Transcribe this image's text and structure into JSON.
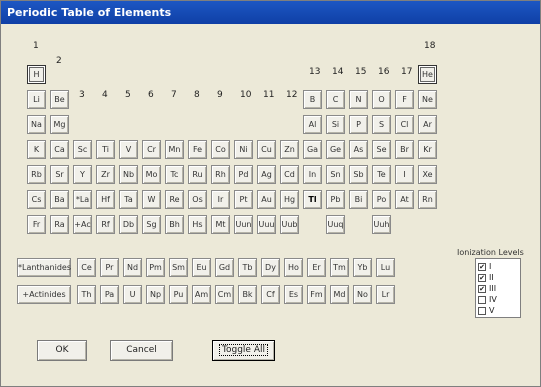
{
  "window": {
    "title": "Periodic Table of Elements"
  },
  "groups": [
    "1",
    "2",
    "3",
    "4",
    "5",
    "6",
    "7",
    "8",
    "9",
    "10",
    "11",
    "12",
    "13",
    "14",
    "15",
    "16",
    "17",
    "18"
  ],
  "rows": [
    [
      "H",
      null,
      null,
      null,
      null,
      null,
      null,
      null,
      null,
      null,
      null,
      null,
      null,
      null,
      null,
      null,
      null,
      "He"
    ],
    [
      "Li",
      "Be",
      null,
      null,
      null,
      null,
      null,
      null,
      null,
      null,
      null,
      null,
      "B",
      "C",
      "N",
      "O",
      "F",
      "Ne"
    ],
    [
      "Na",
      "Mg",
      null,
      null,
      null,
      null,
      null,
      null,
      null,
      null,
      null,
      null,
      "Al",
      "Si",
      "P",
      "S",
      "Cl",
      "Ar"
    ],
    [
      "K",
      "Ca",
      "Sc",
      "Ti",
      "V",
      "Cr",
      "Mn",
      "Fe",
      "Co",
      "Ni",
      "Cu",
      "Zn",
      "Ga",
      "Ge",
      "As",
      "Se",
      "Br",
      "Kr"
    ],
    [
      "Rb",
      "Sr",
      "Y",
      "Zr",
      "Nb",
      "Mo",
      "Tc",
      "Ru",
      "Rh",
      "Pd",
      "Ag",
      "Cd",
      "In",
      "Sn",
      "Sb",
      "Te",
      "I",
      "Xe"
    ],
    [
      "Cs",
      "Ba",
      "*La",
      "Hf",
      "Ta",
      "W",
      "Re",
      "Os",
      "Ir",
      "Pt",
      "Au",
      "Hg",
      "Tl",
      "Pb",
      "Bi",
      "Po",
      "At",
      "Rn"
    ],
    [
      "Fr",
      "Ra",
      "+Ac",
      "Rf",
      "Db",
      "Sg",
      "Bh",
      "Hs",
      "Mt",
      "Uun",
      "Uuu",
      "Uub",
      null,
      "Uuq",
      null,
      "Uuh",
      null,
      null
    ]
  ],
  "lanthanides": {
    "label": "*Lanthanides",
    "elements": [
      "Ce",
      "Pr",
      "Nd",
      "Pm",
      "Sm",
      "Eu",
      "Gd",
      "Tb",
      "Dy",
      "Ho",
      "Er",
      "Tm",
      "Yb",
      "Lu"
    ]
  },
  "actinides": {
    "label": "+Actinides",
    "elements": [
      "Th",
      "Pa",
      "U",
      "Np",
      "Pu",
      "Am",
      "Cm",
      "Bk",
      "Cf",
      "Es",
      "Fm",
      "Md",
      "No",
      "Lr"
    ]
  },
  "ionization": {
    "title": "Ionization Levels",
    "levels": [
      {
        "label": "I",
        "checked": true
      },
      {
        "label": "II",
        "checked": true
      },
      {
        "label": "III",
        "checked": true
      },
      {
        "label": "IV",
        "checked": false
      },
      {
        "label": "V",
        "checked": false
      }
    ]
  },
  "buttons": {
    "ok": "OK",
    "cancel": "Cancel",
    "toggle_all": "Toggle All"
  },
  "colors": {
    "titlebar": "#1d57c3",
    "dialog": "#ece9d8"
  }
}
